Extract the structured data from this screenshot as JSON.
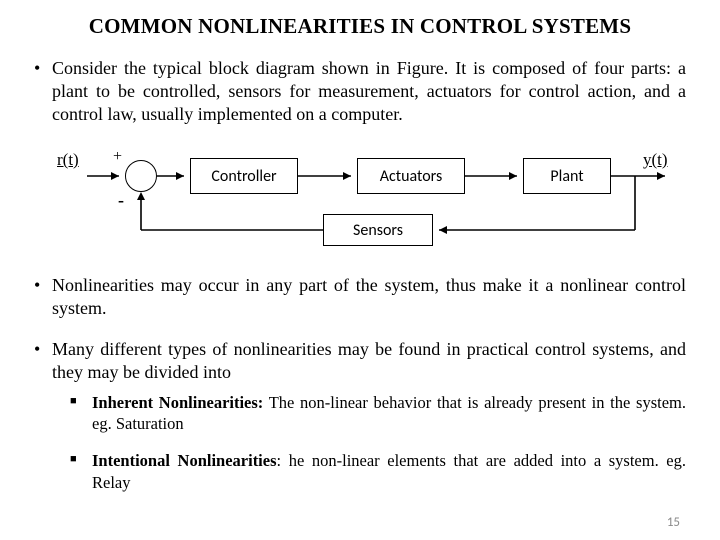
{
  "title": "COMMON NONLINEARITIES IN CONTROL SYSTEMS",
  "bullets": {
    "b1": "Consider the typical block diagram shown in Figure. It is composed of four parts: a plant to be controlled, sensors for measurement, actuators for control action, and a control law, usually implemented on a computer.",
    "b2": "Nonlinearities may occur in any part of the system, thus make it a nonlinear control system.",
    "b3": "Many different types of nonlinearities may be found in practical control systems, and they may be divided into",
    "s1_label": "Inherent Nonlinearities:",
    "s1_text": " The non-linear behavior that is already present in the system. eg. Saturation",
    "s2_label": "Intentional Nonlinearities",
    "s2_text": ": he non-linear elements that are added into a system. eg. Relay"
  },
  "diagram": {
    "r": "r(t)",
    "y": "y(t)",
    "plus": "+",
    "minus": "-",
    "controller": "Controller",
    "actuators": "Actuators",
    "plant": "Plant",
    "sensors": "Sensors"
  },
  "slide_number": "15"
}
